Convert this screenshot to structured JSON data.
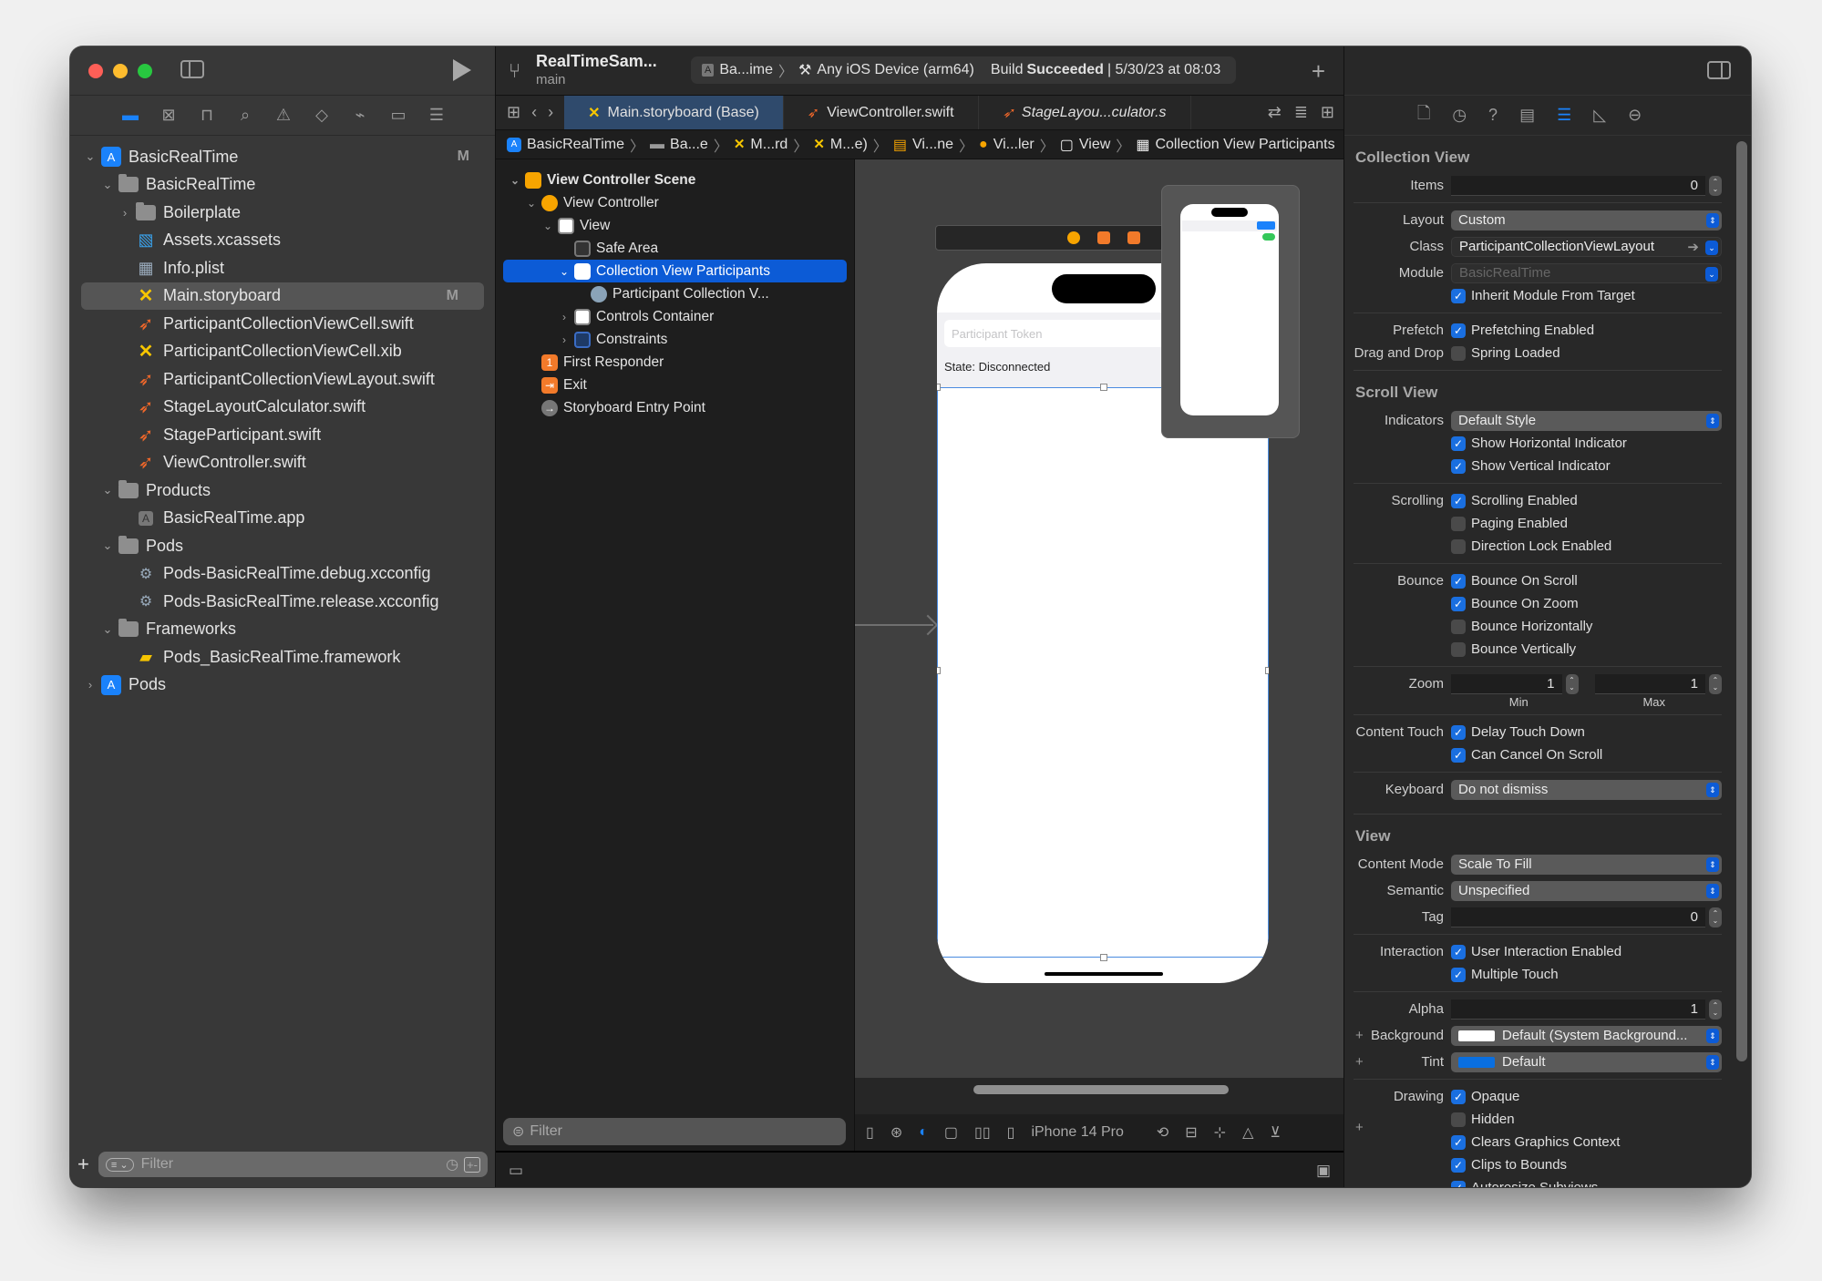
{
  "window": {
    "scheme_name": "RealTimeSam...",
    "branch": "main",
    "activity": {
      "target": "Ba...ime",
      "device": "Any iOS Device (arm64)",
      "status_prefix": "Build",
      "status": "Succeeded",
      "timestamp": "| 5/30/23 at 08:03"
    }
  },
  "navigator": {
    "tabs": [
      "folder-icon",
      "x-square-icon",
      "hierarchy-icon",
      "search-icon",
      "warning-icon",
      "test-diamond-icon",
      "spray-icon",
      "tag-icon",
      "report-icon"
    ],
    "items": [
      {
        "label": "BasicRealTime",
        "icon": "project",
        "depth": 0,
        "chevron": "down",
        "badge": "M"
      },
      {
        "label": "BasicRealTime",
        "icon": "folder",
        "depth": 1,
        "chevron": "down"
      },
      {
        "label": "Boilerplate",
        "icon": "folder",
        "depth": 2,
        "chevron": "right"
      },
      {
        "label": "Assets.xcassets",
        "icon": "assets",
        "depth": 2
      },
      {
        "label": "Info.plist",
        "icon": "plist",
        "depth": 2
      },
      {
        "label": "Main.storyboard",
        "icon": "storyboard",
        "depth": 2,
        "badge": "M",
        "selected": true
      },
      {
        "label": "ParticipantCollectionViewCell.swift",
        "icon": "swift",
        "depth": 2
      },
      {
        "label": "ParticipantCollectionViewCell.xib",
        "icon": "storyboard",
        "depth": 2
      },
      {
        "label": "ParticipantCollectionViewLayout.swift",
        "icon": "swift",
        "depth": 2
      },
      {
        "label": "StageLayoutCalculator.swift",
        "icon": "swift",
        "depth": 2
      },
      {
        "label": "StageParticipant.swift",
        "icon": "swift",
        "depth": 2
      },
      {
        "label": "ViewController.swift",
        "icon": "swift",
        "depth": 2
      },
      {
        "label": "Products",
        "icon": "folder",
        "depth": 1,
        "chevron": "down"
      },
      {
        "label": "BasicRealTime.app",
        "icon": "app",
        "depth": 2
      },
      {
        "label": "Pods",
        "icon": "folder",
        "depth": 1,
        "chevron": "down"
      },
      {
        "label": "Pods-BasicRealTime.debug.xcconfig",
        "icon": "config",
        "depth": 2
      },
      {
        "label": "Pods-BasicRealTime.release.xcconfig",
        "icon": "config",
        "depth": 2
      },
      {
        "label": "Frameworks",
        "icon": "folder",
        "depth": 1,
        "chevron": "down"
      },
      {
        "label": "Pods_BasicRealTime.framework",
        "icon": "framework",
        "depth": 2
      },
      {
        "label": "Pods",
        "icon": "project",
        "depth": 0,
        "chevron": "right"
      }
    ],
    "filter_placeholder": "Filter"
  },
  "editor": {
    "tabs": [
      {
        "label": "Main.storyboard (Base)",
        "icon": "storyboard",
        "active": true
      },
      {
        "label": "ViewController.swift",
        "icon": "swift"
      },
      {
        "label": "StageLayou...culator.s",
        "icon": "swift",
        "italic": true
      }
    ],
    "jumpbar": [
      {
        "label": "BasicRealTime",
        "icon": "project"
      },
      {
        "label": "Ba...e",
        "icon": "folder"
      },
      {
        "label": "M...rd",
        "icon": "storyboard"
      },
      {
        "label": "M...e)",
        "icon": "storyboard"
      },
      {
        "label": "Vi...ne",
        "icon": "scene"
      },
      {
        "label": "Vi...ler",
        "icon": "vc"
      },
      {
        "label": "View",
        "icon": "view"
      },
      {
        "label": "Collection View Participants",
        "icon": "grid"
      }
    ],
    "outline": [
      {
        "label": "View Controller Scene",
        "icon": "scene",
        "depth": 0,
        "chevron": "down",
        "bold": true
      },
      {
        "label": "View Controller",
        "icon": "vc",
        "depth": 1,
        "chevron": "down"
      },
      {
        "label": "View",
        "icon": "view",
        "depth": 2,
        "chevron": "down"
      },
      {
        "label": "Safe Area",
        "icon": "safearea",
        "depth": 3
      },
      {
        "label": "Collection View Participants",
        "icon": "grid",
        "depth": 3,
        "chevron": "down",
        "selected": true
      },
      {
        "label": "Participant Collection V...",
        "icon": "cell",
        "depth": 4
      },
      {
        "label": "Controls Container",
        "icon": "view",
        "depth": 3,
        "chevron": "right"
      },
      {
        "label": "Constraints",
        "icon": "constraints",
        "depth": 3,
        "chevron": "right"
      },
      {
        "label": "First Responder",
        "icon": "responder",
        "depth": 1
      },
      {
        "label": "Exit",
        "icon": "exit",
        "depth": 1
      },
      {
        "label": "Storyboard Entry Point",
        "icon": "entry",
        "depth": 1
      }
    ],
    "outline_filter_placeholder": "Filter",
    "canvas": {
      "token_placeholder": "Participant Token",
      "state_label": "State: Disconnected"
    },
    "device": "iPhone 14 Pro"
  },
  "inspector": {
    "collection_view": {
      "title": "Collection View",
      "items_label": "Items",
      "items": "0",
      "layout_label": "Layout",
      "layout": "Custom",
      "class_label": "Class",
      "class": "ParticipantCollectionViewLayout",
      "module_label": "Module",
      "module": "BasicRealTime",
      "inherit_module": {
        "label": "Inherit Module From Target",
        "checked": true
      },
      "prefetch_label": "Prefetch",
      "prefetch": {
        "label": "Prefetching Enabled",
        "checked": true
      },
      "dnd_label": "Drag and Drop",
      "spring_loaded": {
        "label": "Spring Loaded",
        "checked": false
      }
    },
    "scroll_view": {
      "title": "Scroll View",
      "indicators_label": "Indicators",
      "indicators": "Default Style",
      "show_h": {
        "label": "Show Horizontal Indicator",
        "checked": true
      },
      "show_v": {
        "label": "Show Vertical Indicator",
        "checked": true
      },
      "scrolling_label": "Scrolling",
      "scrolling_enabled": {
        "label": "Scrolling Enabled",
        "checked": true
      },
      "paging_enabled": {
        "label": "Paging Enabled",
        "checked": false
      },
      "direction_lock": {
        "label": "Direction Lock Enabled",
        "checked": false
      },
      "bounce_label": "Bounce",
      "bounce_scroll": {
        "label": "Bounce On Scroll",
        "checked": true
      },
      "bounce_zoom": {
        "label": "Bounce On Zoom",
        "checked": true
      },
      "bounce_h": {
        "label": "Bounce Horizontally",
        "checked": false
      },
      "bounce_v": {
        "label": "Bounce Vertically",
        "checked": false
      },
      "zoom_label": "Zoom",
      "zoom_min": "1",
      "zoom_max": "1",
      "min_label": "Min",
      "max_label": "Max",
      "content_touch_label": "Content Touch",
      "delay_touch": {
        "label": "Delay Touch Down",
        "checked": true
      },
      "cancel_scroll": {
        "label": "Can Cancel On Scroll",
        "checked": true
      },
      "keyboard_label": "Keyboard",
      "keyboard": "Do not dismiss"
    },
    "view": {
      "title": "View",
      "content_mode_label": "Content Mode",
      "content_mode": "Scale To Fill",
      "semantic_label": "Semantic",
      "semantic": "Unspecified",
      "tag_label": "Tag",
      "tag": "0",
      "interaction_label": "Interaction",
      "user_interaction": {
        "label": "User Interaction Enabled",
        "checked": true
      },
      "multiple_touch": {
        "label": "Multiple Touch",
        "checked": true
      },
      "alpha_label": "Alpha",
      "alpha": "1",
      "background_label": "Background",
      "background": "Default (System Background...",
      "background_color": "#ffffff",
      "tint_label": "Tint",
      "tint": "Default",
      "tint_color": "#0a6fe0",
      "drawing_label": "Drawing",
      "opaque": {
        "label": "Opaque",
        "checked": true
      },
      "hidden": {
        "label": "Hidden",
        "checked": false
      },
      "clears_context": {
        "label": "Clears Graphics Context",
        "checked": true
      },
      "clips_bounds": {
        "label": "Clips to Bounds",
        "checked": true
      },
      "autoresize": {
        "label": "Autoresize Subviews",
        "checked": true
      }
    }
  },
  "colors": {
    "accent": "#1a82fb",
    "selection": "#0c5bd6",
    "swift": "#f2682a",
    "storyboard": "#f7c600"
  }
}
